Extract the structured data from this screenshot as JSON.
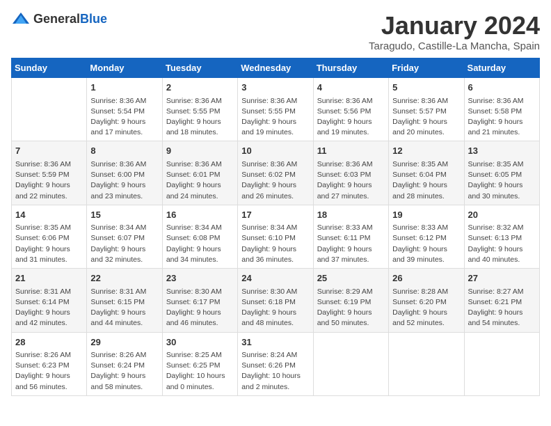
{
  "header": {
    "logo_general": "General",
    "logo_blue": "Blue",
    "month": "January 2024",
    "location": "Taragudo, Castille-La Mancha, Spain"
  },
  "weekdays": [
    "Sunday",
    "Monday",
    "Tuesday",
    "Wednesday",
    "Thursday",
    "Friday",
    "Saturday"
  ],
  "weeks": [
    [
      {
        "day": "",
        "info": ""
      },
      {
        "day": "1",
        "info": "Sunrise: 8:36 AM\nSunset: 5:54 PM\nDaylight: 9 hours\nand 17 minutes."
      },
      {
        "day": "2",
        "info": "Sunrise: 8:36 AM\nSunset: 5:55 PM\nDaylight: 9 hours\nand 18 minutes."
      },
      {
        "day": "3",
        "info": "Sunrise: 8:36 AM\nSunset: 5:55 PM\nDaylight: 9 hours\nand 19 minutes."
      },
      {
        "day": "4",
        "info": "Sunrise: 8:36 AM\nSunset: 5:56 PM\nDaylight: 9 hours\nand 19 minutes."
      },
      {
        "day": "5",
        "info": "Sunrise: 8:36 AM\nSunset: 5:57 PM\nDaylight: 9 hours\nand 20 minutes."
      },
      {
        "day": "6",
        "info": "Sunrise: 8:36 AM\nSunset: 5:58 PM\nDaylight: 9 hours\nand 21 minutes."
      }
    ],
    [
      {
        "day": "7",
        "info": "Sunrise: 8:36 AM\nSunset: 5:59 PM\nDaylight: 9 hours\nand 22 minutes."
      },
      {
        "day": "8",
        "info": "Sunrise: 8:36 AM\nSunset: 6:00 PM\nDaylight: 9 hours\nand 23 minutes."
      },
      {
        "day": "9",
        "info": "Sunrise: 8:36 AM\nSunset: 6:01 PM\nDaylight: 9 hours\nand 24 minutes."
      },
      {
        "day": "10",
        "info": "Sunrise: 8:36 AM\nSunset: 6:02 PM\nDaylight: 9 hours\nand 26 minutes."
      },
      {
        "day": "11",
        "info": "Sunrise: 8:36 AM\nSunset: 6:03 PM\nDaylight: 9 hours\nand 27 minutes."
      },
      {
        "day": "12",
        "info": "Sunrise: 8:35 AM\nSunset: 6:04 PM\nDaylight: 9 hours\nand 28 minutes."
      },
      {
        "day": "13",
        "info": "Sunrise: 8:35 AM\nSunset: 6:05 PM\nDaylight: 9 hours\nand 30 minutes."
      }
    ],
    [
      {
        "day": "14",
        "info": "Sunrise: 8:35 AM\nSunset: 6:06 PM\nDaylight: 9 hours\nand 31 minutes."
      },
      {
        "day": "15",
        "info": "Sunrise: 8:34 AM\nSunset: 6:07 PM\nDaylight: 9 hours\nand 32 minutes."
      },
      {
        "day": "16",
        "info": "Sunrise: 8:34 AM\nSunset: 6:08 PM\nDaylight: 9 hours\nand 34 minutes."
      },
      {
        "day": "17",
        "info": "Sunrise: 8:34 AM\nSunset: 6:10 PM\nDaylight: 9 hours\nand 36 minutes."
      },
      {
        "day": "18",
        "info": "Sunrise: 8:33 AM\nSunset: 6:11 PM\nDaylight: 9 hours\nand 37 minutes."
      },
      {
        "day": "19",
        "info": "Sunrise: 8:33 AM\nSunset: 6:12 PM\nDaylight: 9 hours\nand 39 minutes."
      },
      {
        "day": "20",
        "info": "Sunrise: 8:32 AM\nSunset: 6:13 PM\nDaylight: 9 hours\nand 40 minutes."
      }
    ],
    [
      {
        "day": "21",
        "info": "Sunrise: 8:31 AM\nSunset: 6:14 PM\nDaylight: 9 hours\nand 42 minutes."
      },
      {
        "day": "22",
        "info": "Sunrise: 8:31 AM\nSunset: 6:15 PM\nDaylight: 9 hours\nand 44 minutes."
      },
      {
        "day": "23",
        "info": "Sunrise: 8:30 AM\nSunset: 6:17 PM\nDaylight: 9 hours\nand 46 minutes."
      },
      {
        "day": "24",
        "info": "Sunrise: 8:30 AM\nSunset: 6:18 PM\nDaylight: 9 hours\nand 48 minutes."
      },
      {
        "day": "25",
        "info": "Sunrise: 8:29 AM\nSunset: 6:19 PM\nDaylight: 9 hours\nand 50 minutes."
      },
      {
        "day": "26",
        "info": "Sunrise: 8:28 AM\nSunset: 6:20 PM\nDaylight: 9 hours\nand 52 minutes."
      },
      {
        "day": "27",
        "info": "Sunrise: 8:27 AM\nSunset: 6:21 PM\nDaylight: 9 hours\nand 54 minutes."
      }
    ],
    [
      {
        "day": "28",
        "info": "Sunrise: 8:26 AM\nSunset: 6:23 PM\nDaylight: 9 hours\nand 56 minutes."
      },
      {
        "day": "29",
        "info": "Sunrise: 8:26 AM\nSunset: 6:24 PM\nDaylight: 9 hours\nand 58 minutes."
      },
      {
        "day": "30",
        "info": "Sunrise: 8:25 AM\nSunset: 6:25 PM\nDaylight: 10 hours\nand 0 minutes."
      },
      {
        "day": "31",
        "info": "Sunrise: 8:24 AM\nSunset: 6:26 PM\nDaylight: 10 hours\nand 2 minutes."
      },
      {
        "day": "",
        "info": ""
      },
      {
        "day": "",
        "info": ""
      },
      {
        "day": "",
        "info": ""
      }
    ]
  ]
}
